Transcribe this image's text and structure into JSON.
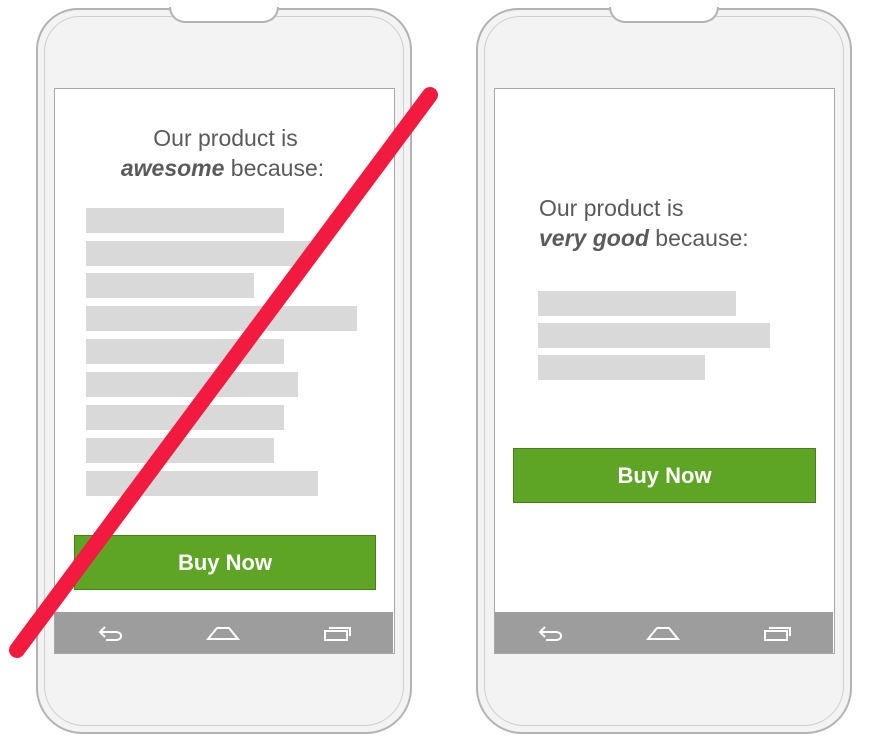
{
  "left_phone": {
    "headline_line1": "Our product is",
    "headline_emphasis": "awesome",
    "headline_suffix": " because:",
    "button_label": "Buy Now",
    "rejected": true
  },
  "right_phone": {
    "headline_line1": "Our product is",
    "headline_emphasis": "very good",
    "headline_suffix": " because:",
    "button_label": "Buy Now",
    "rejected": false
  },
  "colors": {
    "button_green": "#5ea525",
    "strike_red": "#f21b3f",
    "placeholder_gray": "#d9d9d9",
    "navbar_gray": "#9d9d9d"
  },
  "icons": {
    "nav": [
      "back-icon",
      "home-icon",
      "recents-icon"
    ]
  }
}
